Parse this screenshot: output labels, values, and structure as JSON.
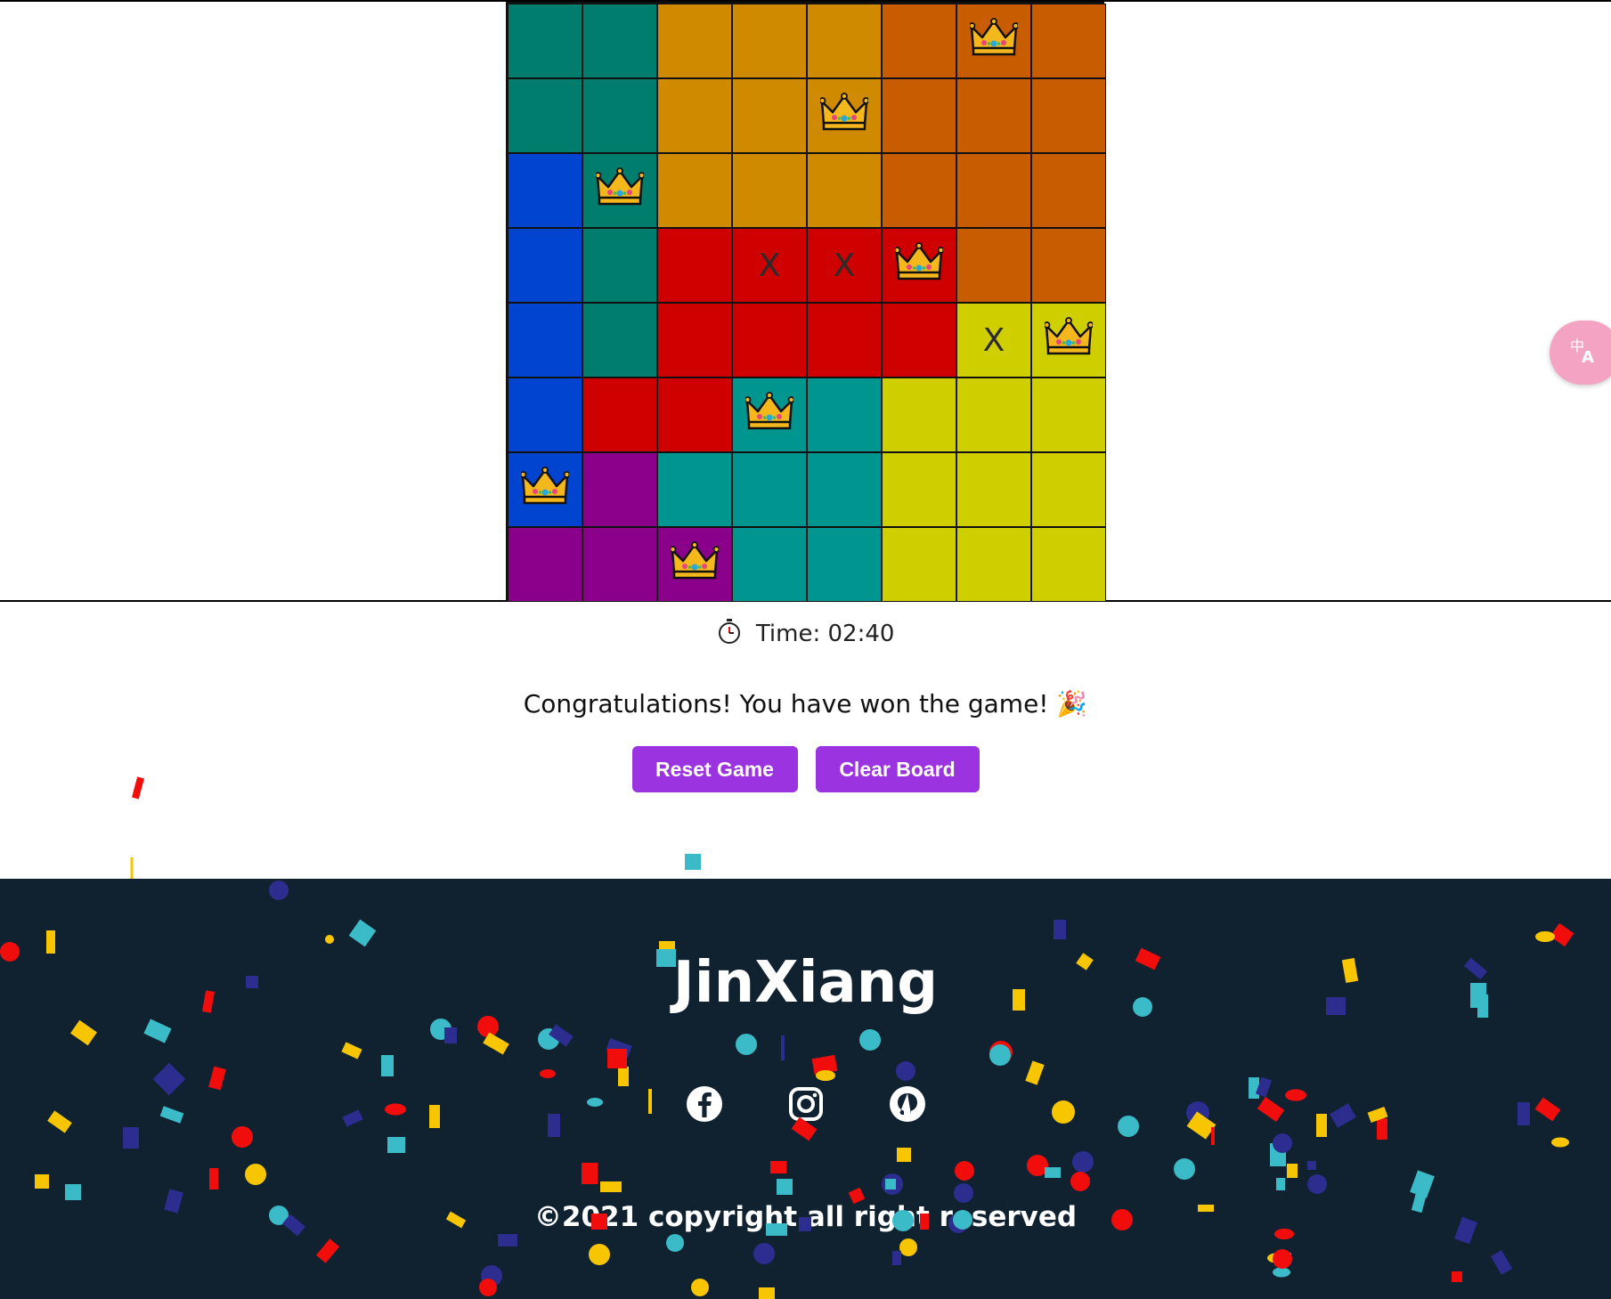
{
  "board": {
    "size": 8,
    "region_colors": {
      "teal_dark": "#007d6c",
      "amber": "#cf8a00",
      "orange": "#c75c00",
      "blue": "#0044d0",
      "red": "#cf0000",
      "yellow": "#cfcf00",
      "purple": "#8b008b",
      "teal": "#00958e"
    },
    "rows": [
      [
        "teal_dark",
        "teal_dark",
        "amber",
        "amber",
        "amber",
        "orange",
        "orange",
        "orange"
      ],
      [
        "teal_dark",
        "teal_dark",
        "amber",
        "amber",
        "amber",
        "orange",
        "orange",
        "orange"
      ],
      [
        "blue",
        "teal_dark",
        "amber",
        "amber",
        "amber",
        "orange",
        "orange",
        "orange"
      ],
      [
        "blue",
        "teal_dark",
        "red",
        "red",
        "red",
        "red",
        "orange",
        "orange"
      ],
      [
        "blue",
        "teal_dark",
        "red",
        "red",
        "red",
        "red",
        "yellow",
        "yellow"
      ],
      [
        "blue",
        "red",
        "red",
        "teal",
        "teal",
        "yellow",
        "yellow",
        "yellow"
      ],
      [
        "blue",
        "purple",
        "teal",
        "teal",
        "teal",
        "yellow",
        "yellow",
        "yellow"
      ],
      [
        "purple",
        "purple",
        "purple",
        "teal",
        "teal",
        "yellow",
        "yellow",
        "yellow"
      ]
    ],
    "marks": [
      [
        "",
        "",
        "",
        "",
        "",
        "",
        "crown",
        ""
      ],
      [
        "",
        "",
        "",
        "",
        "crown",
        "",
        "",
        ""
      ],
      [
        "",
        "crown",
        "",
        "",
        "",
        "",
        "",
        ""
      ],
      [
        "",
        "",
        "",
        "X",
        "X",
        "crown",
        "",
        ""
      ],
      [
        "",
        "",
        "",
        "",
        "",
        "",
        "X",
        "crown"
      ],
      [
        "",
        "",
        "",
        "crown",
        "",
        "",
        "",
        ""
      ],
      [
        "crown",
        "",
        "",
        "",
        "",
        "",
        "",
        ""
      ],
      [
        "",
        "",
        "crown",
        "",
        "",
        "",
        "",
        ""
      ]
    ]
  },
  "timer": {
    "label": "Time: 02:40",
    "icon": "stopwatch-icon"
  },
  "message": {
    "text": "Congratulations! You have won the game! 🎉"
  },
  "buttons": {
    "reset_label": "Reset Game",
    "clear_label": "Clear Board",
    "color": "#9b34e0"
  },
  "translate_widget": {
    "icon": "translate-icon",
    "color": "#f4a3c3"
  },
  "footer": {
    "brand": "JinXiang",
    "socials": [
      "facebook-icon",
      "instagram-icon",
      "github-icon"
    ],
    "copyright": "©2021 copyright all right reserved",
    "background": "#102230"
  },
  "confetti_colors": [
    "#f20d0d",
    "#f7c600",
    "#3bbac7",
    "#2d2d8f"
  ]
}
